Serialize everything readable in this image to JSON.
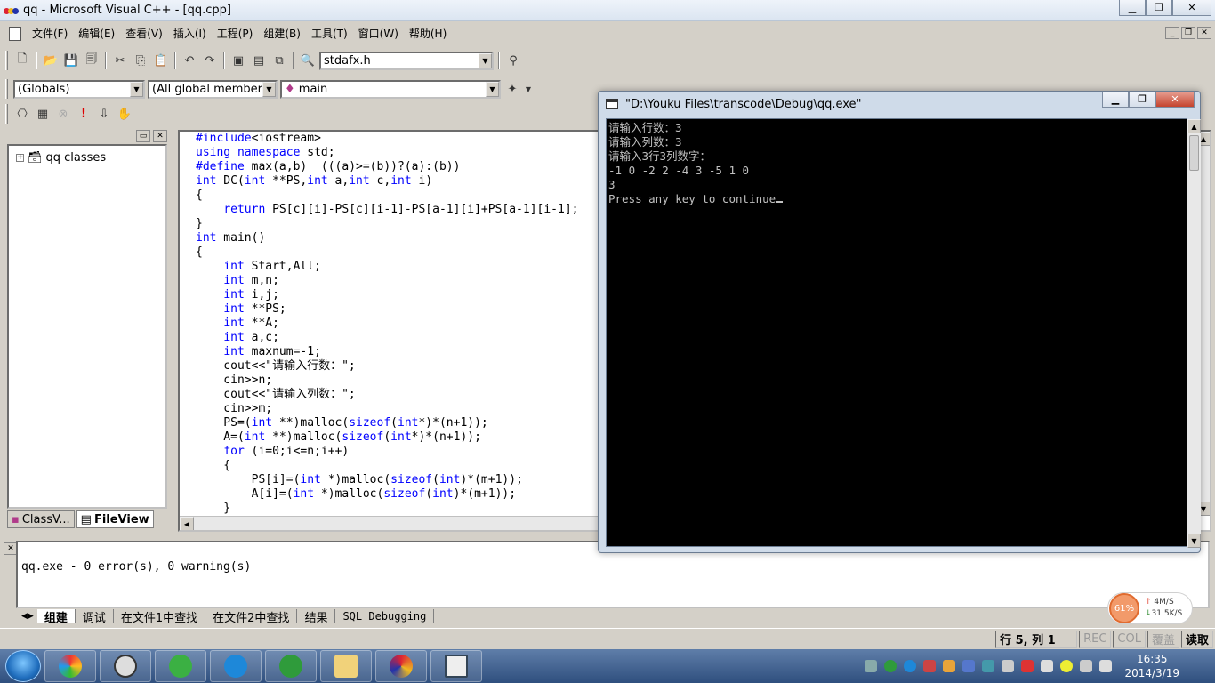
{
  "window": {
    "title": "qq - Microsoft Visual C++ - [qq.cpp]"
  },
  "menu": {
    "items": [
      "文件(F)",
      "编辑(E)",
      "查看(V)",
      "插入(I)",
      "工程(P)",
      "组建(B)",
      "工具(T)",
      "窗口(W)",
      "帮助(H)"
    ]
  },
  "toolbar": {
    "file_combo": "stdafx.h",
    "class_combo": "(Globals)",
    "members_combo": "(All global members",
    "function_combo": "main"
  },
  "workspace": {
    "tree_root": "qq classes",
    "tabs": [
      "ClassV...",
      "FileView"
    ]
  },
  "editor": {
    "lines": [
      [
        [
          "kw",
          "#include"
        ],
        [
          "",
          "<iostream>"
        ]
      ],
      [
        [
          "kw",
          "using"
        ],
        [
          "",
          " "
        ],
        [
          "kw",
          "namespace"
        ],
        [
          "",
          " std;"
        ]
      ],
      [
        [
          "kw",
          "#define"
        ],
        [
          "",
          " max(a,b)  (((a)>=(b))?(a):(b))"
        ]
      ],
      [
        [
          "kw",
          "int"
        ],
        [
          "",
          " DC("
        ],
        [
          "kw",
          "int"
        ],
        [
          "",
          " **PS,"
        ],
        [
          "kw",
          "int"
        ],
        [
          "",
          " a,"
        ],
        [
          "kw",
          "int"
        ],
        [
          "",
          " c,"
        ],
        [
          "kw",
          "int"
        ],
        [
          "",
          " i)"
        ]
      ],
      [
        [
          "",
          "{"
        ]
      ],
      [
        [
          "",
          "    "
        ],
        [
          "kw",
          "return"
        ],
        [
          "",
          " PS[c][i]-PS[c][i-1]-PS[a-1][i]+PS[a-1][i-1];"
        ]
      ],
      [
        [
          "",
          "}"
        ]
      ],
      [
        [
          "kw",
          "int"
        ],
        [
          "",
          " main()"
        ]
      ],
      [
        [
          "",
          "{"
        ]
      ],
      [
        [
          "",
          "    "
        ],
        [
          "kw",
          "int"
        ],
        [
          "",
          " Start,All;"
        ]
      ],
      [
        [
          "",
          "    "
        ],
        [
          "kw",
          "int"
        ],
        [
          "",
          " m,n;"
        ]
      ],
      [
        [
          "",
          "    "
        ],
        [
          "kw",
          "int"
        ],
        [
          "",
          " i,j;"
        ]
      ],
      [
        [
          "",
          "    "
        ],
        [
          "kw",
          "int"
        ],
        [
          "",
          " **PS;"
        ]
      ],
      [
        [
          "",
          "    "
        ],
        [
          "kw",
          "int"
        ],
        [
          "",
          " **A;"
        ]
      ],
      [
        [
          "",
          "    "
        ],
        [
          "kw",
          "int"
        ],
        [
          "",
          " a,c;"
        ]
      ],
      [
        [
          "",
          "    "
        ],
        [
          "kw",
          "int"
        ],
        [
          "",
          " maxnum=-1;"
        ]
      ],
      [
        [
          "",
          "    cout<<\"请输入行数：\";"
        ]
      ],
      [
        [
          "",
          "    cin>>n;"
        ]
      ],
      [
        [
          "",
          "    cout<<\"请输入列数：\";"
        ]
      ],
      [
        [
          "",
          "    cin>>m;"
        ]
      ],
      [
        [
          "",
          "    PS=("
        ],
        [
          "kw",
          "int"
        ],
        [
          "",
          " **)malloc("
        ],
        [
          "kw",
          "sizeof"
        ],
        [
          "",
          "("
        ],
        [
          "kw",
          "int"
        ],
        [
          "",
          "*)*(n+1));"
        ]
      ],
      [
        [
          "",
          "    A=("
        ],
        [
          "kw",
          "int"
        ],
        [
          "",
          " **)malloc("
        ],
        [
          "kw",
          "sizeof"
        ],
        [
          "",
          "("
        ],
        [
          "kw",
          "int"
        ],
        [
          "",
          "*)*(n+1));"
        ]
      ],
      [
        [
          "",
          "    "
        ],
        [
          "kw",
          "for"
        ],
        [
          "",
          " (i=0;i<=n;i++)"
        ]
      ],
      [
        [
          "",
          "    {"
        ]
      ],
      [
        [
          "",
          "        PS[i]=("
        ],
        [
          "kw",
          "int"
        ],
        [
          "",
          " *)malloc("
        ],
        [
          "kw",
          "sizeof"
        ],
        [
          "",
          "("
        ],
        [
          "kw",
          "int"
        ],
        [
          "",
          ")*(m+1));"
        ]
      ],
      [
        [
          "",
          "        A[i]=("
        ],
        [
          "kw",
          "int"
        ],
        [
          "",
          " *)malloc("
        ],
        [
          "kw",
          "sizeof"
        ],
        [
          "",
          "("
        ],
        [
          "kw",
          "int"
        ],
        [
          "",
          ")*(m+1));"
        ]
      ],
      [
        [
          "",
          "    }"
        ]
      ]
    ]
  },
  "output": {
    "text": "qq.exe - 0 error(s), 0 warning(s)",
    "tabs": [
      "组建",
      "调试",
      "在文件1中查找",
      "在文件2中查找",
      "结果",
      "SQL Debugging"
    ]
  },
  "status": {
    "position": "行 5, 列 1",
    "rec": "REC",
    "col": "COL",
    "ovr": "覆盖",
    "read": "读取"
  },
  "console": {
    "title": "\"D:\\Youku Files\\transcode\\Debug\\qq.exe\"",
    "lines": [
      "请输入行数：3",
      "请输入列数：3",
      "请输入3行3列数字：",
      "-1 0 -2 2 -4 3 -5 1 0",
      "3",
      "Press any key to continue"
    ]
  },
  "netmeter": {
    "percent": "61%",
    "up": "4M/S",
    "down": "31.5K/S"
  },
  "clock": {
    "time": "16:35",
    "date": "2014/3/19"
  },
  "colors": {
    "keyword": "#0000ff",
    "console_bg": "#000000",
    "console_fg": "#c0c0c0",
    "taskbar": "#2f4f7e"
  }
}
